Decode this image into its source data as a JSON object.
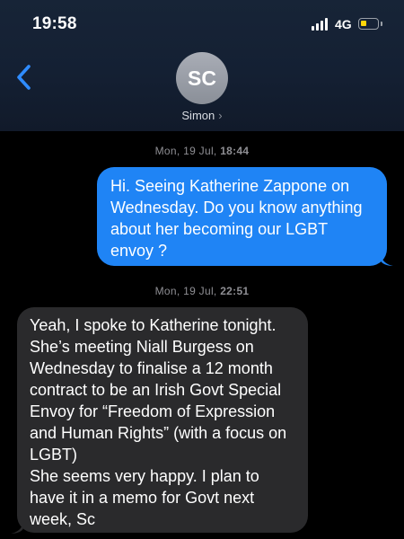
{
  "status_bar": {
    "time": "19:58",
    "network": "4G",
    "battery_level": 0.35,
    "battery_color": "#ffd60a"
  },
  "header": {
    "back_icon": "chevron-left-icon",
    "accent": "#2f8cff",
    "avatar_initials": "SC",
    "contact_name": "Simon",
    "contact_chevron": "›"
  },
  "messages": [
    {
      "timestamp_day": "Mon, 19 Jul,",
      "timestamp_time": "18:44",
      "direction": "sent",
      "bubble_color": "#1f84f5",
      "text": "Hi. Seeing Katherine Zappone on Wednesday. Do you know anything about her becoming our LGBT envoy ?"
    },
    {
      "timestamp_day": "Mon, 19 Jul,",
      "timestamp_time": "22:51",
      "direction": "received",
      "bubble_color": "#2a2a2c",
      "text": "Yeah, I spoke to Katherine tonight. She’s meeting Niall Burgess on Wednesday to finalise a 12 month contract to be an Irish Govt Special Envoy for “Freedom of Expression and Human Rights” (with a focus on LGBT)\nShe seems very happy. I plan to have it in a memo for Govt next week, Sc"
    }
  ]
}
